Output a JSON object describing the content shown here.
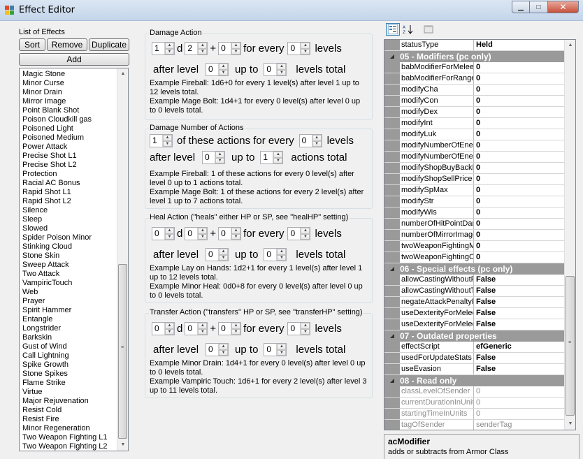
{
  "window": {
    "title": "Effect Editor",
    "close_glyph": "✕",
    "min_glyph": "▁",
    "max_glyph": "□"
  },
  "list_panel": {
    "title": "List of Effects",
    "buttons": {
      "sort": "Sort",
      "remove": "Remove",
      "duplicate": "Duplicate",
      "add": "Add"
    },
    "items": [
      "Magic Stone",
      "Minor Curse",
      "Minor Drain",
      "Mirror Image",
      "Point Blank Shot",
      "Poison Cloudkill gas",
      "Poisoned Light",
      "Poisoned Medium",
      "Power Attack",
      "Precise Shot L1",
      "Precise Shot L2",
      "Protection",
      "Racial AC Bonus",
      "Rapid Shot L1",
      "Rapid Shot L2",
      "Silence",
      "Sleep",
      "Slowed",
      "Spider Poison Minor",
      "Stinking Cloud",
      "Stone Skin",
      "Sweep Attack",
      "Two Attack",
      "VampiricTouch",
      "Web",
      "Prayer",
      "Spirit Hammer",
      "Entangle",
      "Longstrider",
      "Barkskin",
      "Gust of Wind",
      "Call Lightning",
      "Spike Growth",
      "Stone Spikes",
      "Flame Strike",
      "Virtue",
      "Major Rejuvenation",
      "Resist Cold",
      "Resist Fire",
      "Minor Regeneration",
      "Two Weapon Fighting L1",
      "Two Weapon Fighting L2"
    ]
  },
  "damage_action": {
    "title": "Damage Action",
    "dice": "1",
    "d": "d",
    "sides": "2",
    "plus": "+",
    "bonus": "0",
    "for_every": "for every",
    "every_levels": "0",
    "levels": "levels",
    "after_level": "after level",
    "after_val": "0",
    "up_to": "up to",
    "upto_val": "0",
    "levels_total": "levels total",
    "example1": "Example Fireball: 1d6+0 for every 1 level(s) after level 1 up to 12 levels total.",
    "example2": "Example Mage Bolt: 1d4+1 for every 0 level(s) after level 0 up to 0 levels total."
  },
  "damage_number": {
    "title": "Damage Number of Actions",
    "count": "1",
    "of_these": "of these actions for every",
    "every_levels": "0",
    "levels": "levels",
    "after_level": "after level",
    "after_val": "0",
    "up_to": "up to",
    "upto_val": "1",
    "actions_total": "actions total",
    "example1": "Example Fireball: 1 of these actions for every 0 level(s) after level 0 up to 1 actions total.",
    "example2": "Example Mage Bolt: 1 of these actions for every 2 level(s) after level 1 up to 7 actions total."
  },
  "heal_action": {
    "title": "Heal Action (\"heals\" either HP or SP, see \"healHP\" setting)",
    "dice": "0",
    "d": "d",
    "sides": "0",
    "plus": "+",
    "bonus": "0",
    "for_every": "for every",
    "every_levels": "0",
    "levels": "levels",
    "after_level": "after level",
    "after_val": "0",
    "up_to": "up to",
    "upto_val": "0",
    "levels_total": "levels total",
    "example1": "Example Lay on Hands: 1d2+1 for every 1 level(s) after level 1 up to 12 levels total.",
    "example2": "Example Minor Heal: 0d0+8 for every 0 level(s) after level 0 up to 0 levels total."
  },
  "transfer_action": {
    "title": "Transfer Action (\"transfers\" HP or SP, see \"transferHP\" setting)",
    "dice": "0",
    "d": "d",
    "sides": "0",
    "plus": "+",
    "bonus": "0",
    "for_every": "for every",
    "every_levels": "0",
    "levels": "levels",
    "after_level": "after level",
    "after_val": "0",
    "up_to": "up to",
    "upto_val": "0",
    "levels_total": "levels total",
    "example1": "Example Minor Drain: 1d4+1 for every 0 level(s) after level 0 up to 0 levels total.",
    "example2": "Example Vampiric Touch: 1d6+1 for every 2 level(s) after level 3 up to 11 levels total."
  },
  "property_grid": {
    "top_row": {
      "name": "statusType",
      "value": "Held"
    },
    "categories": [
      {
        "title": "05 - Modifiers (pc only)",
        "rows": [
          {
            "name": "babModifierForMeleeA",
            "value": "0"
          },
          {
            "name": "babModifierForRange",
            "value": "0"
          },
          {
            "name": "modifyCha",
            "value": "0"
          },
          {
            "name": "modifyCon",
            "value": "0"
          },
          {
            "name": "modifyDex",
            "value": "0"
          },
          {
            "name": "modifyInt",
            "value": "0"
          },
          {
            "name": "modifyLuk",
            "value": "0"
          },
          {
            "name": "modifyNumberOfEnem",
            "value": "0"
          },
          {
            "name": "modifyNumberOfEnem",
            "value": "0"
          },
          {
            "name": "modifyShopBuyBackP",
            "value": "0"
          },
          {
            "name": "modifyShopSellPrice",
            "value": "0"
          },
          {
            "name": "modifySpMax",
            "value": "0"
          },
          {
            "name": "modifyStr",
            "value": "0"
          },
          {
            "name": "modifyWis",
            "value": "0"
          },
          {
            "name": "numberOfHitPointDam",
            "value": "0"
          },
          {
            "name": "numberOfMirrorImages",
            "value": "0"
          },
          {
            "name": "twoWeaponFightingM",
            "value": "0"
          },
          {
            "name": "twoWeaponFightingO",
            "value": "0"
          }
        ]
      },
      {
        "title": "06 - Special effects (pc only)",
        "rows": [
          {
            "name": "allowCastingWithoutR",
            "value": "False"
          },
          {
            "name": "allowCastingWithoutT",
            "value": "False"
          },
          {
            "name": "negateAttackPenaltyF",
            "value": "False"
          },
          {
            "name": "useDexterityForMelee",
            "value": "False"
          },
          {
            "name": "useDexterityForMelee",
            "value": "False"
          }
        ]
      },
      {
        "title": "07 - Outdated properties",
        "rows": [
          {
            "name": "effectScript",
            "value": "efGeneric"
          },
          {
            "name": "usedForUpdateStats",
            "value": "False"
          },
          {
            "name": "useEvasion",
            "value": "False"
          }
        ]
      },
      {
        "title": "08 - Read only",
        "readonly": true,
        "rows": [
          {
            "name": "classLevelOfSender",
            "value": "0"
          },
          {
            "name": "currentDurationInUnits",
            "value": "0"
          },
          {
            "name": "startingTimeInUnits",
            "value": "0"
          },
          {
            "name": "tagOfSender",
            "value": "senderTag"
          }
        ]
      }
    ],
    "help": {
      "name": "acModifier",
      "description": "adds or subtracts from Armor Class"
    }
  },
  "colors": {
    "category_bg": "#9a9a9a",
    "accent": "#3c7fb1",
    "close": "#c7503a"
  },
  "icons": [
    "categorized-view-icon",
    "alphabetical-sort-icon",
    "property-pages-icon",
    "expander-icon",
    "scroll-up-icon",
    "scroll-down-icon"
  ]
}
